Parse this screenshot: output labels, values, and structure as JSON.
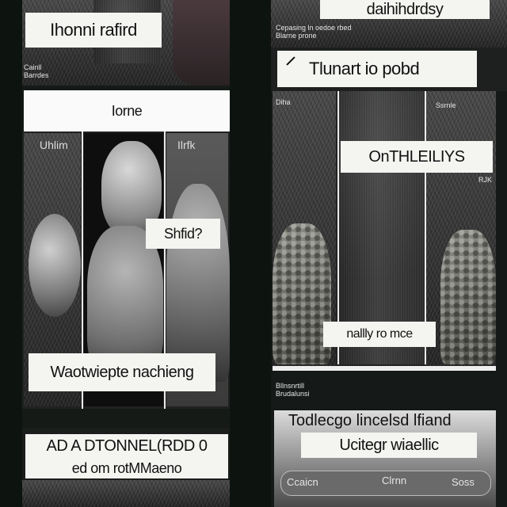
{
  "left": {
    "top_label": "Ihonni rafird",
    "top_caption": "Cainll\nBarrdes",
    "band_label": "Iorne",
    "strip_left": "Uhlim",
    "strip_right": "Ilrfk",
    "mid_label": "Shfid?",
    "bottom_label": "Waotwiepte nachieng",
    "footer_line1": "AD A DTONNEL(RDD 0",
    "footer_line2": "ed om rotMMaeno"
  },
  "right": {
    "top_label": "daihihdrdsy",
    "top_caption": "Cepasing ln oedoe rbed\nBlarne prone",
    "quote_label": "Tlunart io pobd",
    "side_caption1": "Diha",
    "side_caption2": "Ssrnle",
    "mid_label": "OnTHLEILIYS",
    "mid_small": "RJK",
    "bottom_label": "nallly ro mce",
    "small_caption": "Bllnsnrtill\nBrudalunsi",
    "footer_line1": "Todlecgo lincelsd lfiand",
    "footer_line2": "Ucitegr wiaellic",
    "footer_tags": [
      "Ccaicn",
      "Clrnn",
      "Soss"
    ]
  }
}
